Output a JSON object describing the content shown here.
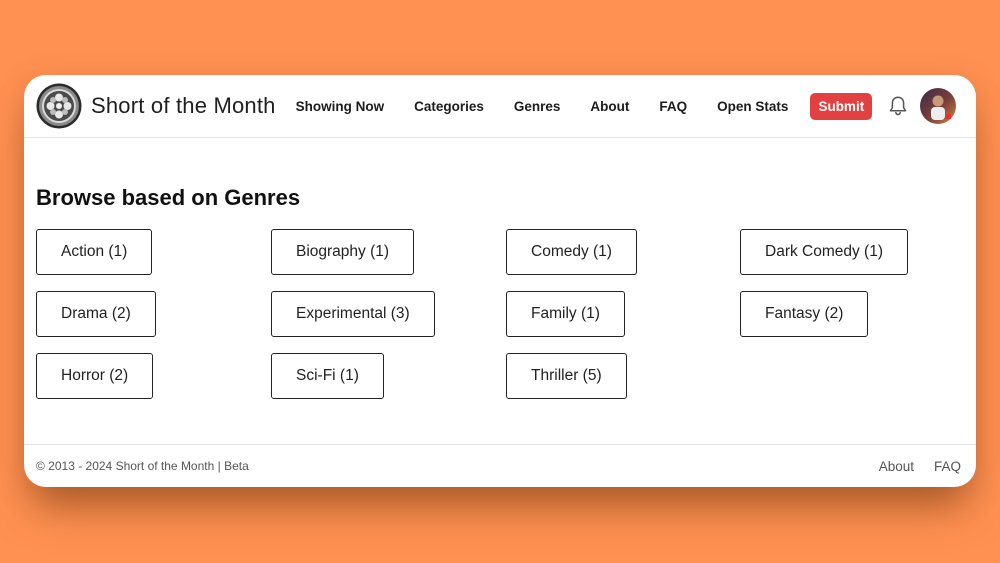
{
  "header": {
    "brand": "Short of the Month",
    "logo_icon": "film-reel-icon",
    "nav": [
      {
        "label": "Showing Now"
      },
      {
        "label": "Categories"
      },
      {
        "label": "Genres"
      },
      {
        "label": "About"
      },
      {
        "label": "FAQ"
      },
      {
        "label": "Open Stats"
      }
    ],
    "submit_label": "Submit",
    "notification_icon": "bell-icon",
    "avatar_icon": "user-avatar"
  },
  "main": {
    "title": "Browse based on Genres",
    "genres": [
      {
        "label": "Action (1)"
      },
      {
        "label": "Biography (1)"
      },
      {
        "label": "Comedy (1)"
      },
      {
        "label": "Dark Comedy (1)"
      },
      {
        "label": "Drama (2)"
      },
      {
        "label": "Experimental (3)"
      },
      {
        "label": "Family (1)"
      },
      {
        "label": "Fantasy (2)"
      },
      {
        "label": "Horror (2)"
      },
      {
        "label": "Sci-Fi (1)"
      },
      {
        "label": "Thriller (5)"
      }
    ]
  },
  "footer": {
    "copyright": "© 2013 - 2024 Short of the Month | Beta",
    "links": [
      {
        "label": "About"
      },
      {
        "label": "FAQ"
      }
    ]
  },
  "colors": {
    "background": "#ff9152",
    "submit": "#e34141",
    "text": "#1c1c1c"
  }
}
